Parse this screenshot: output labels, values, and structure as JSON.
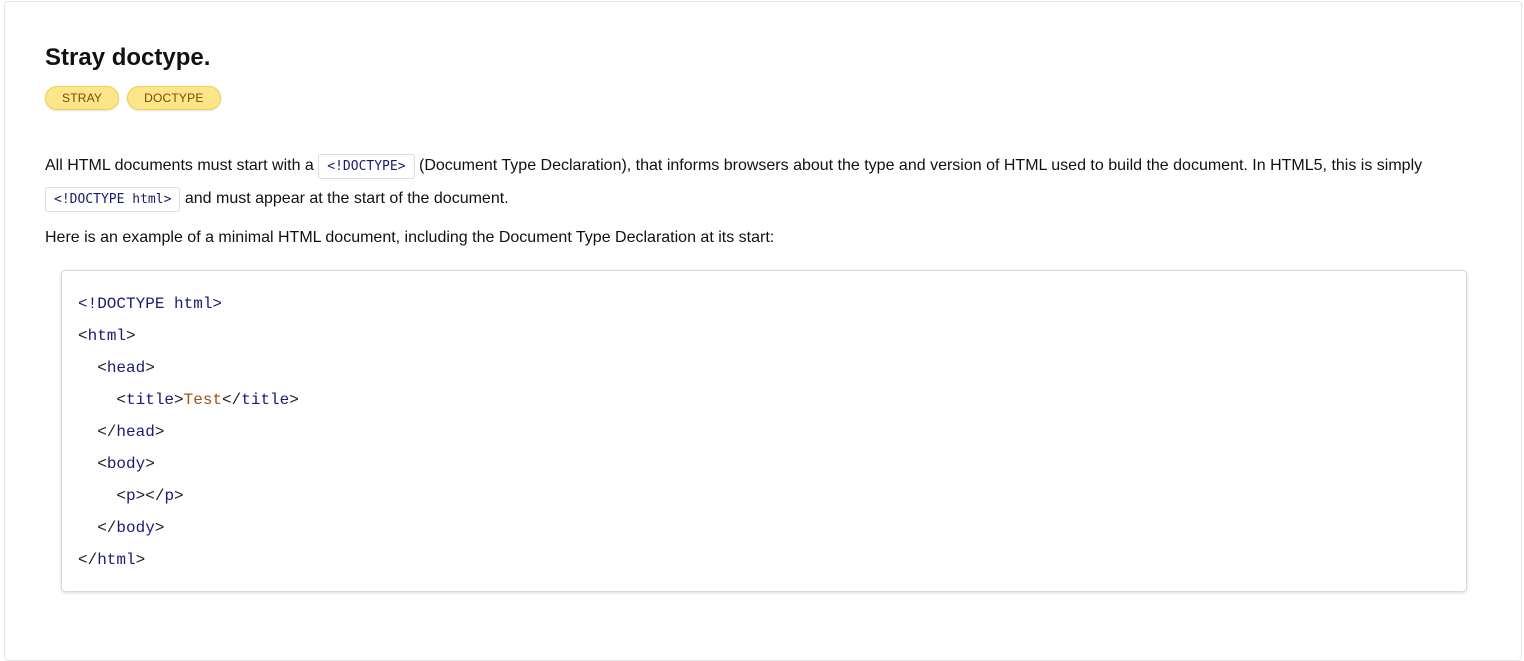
{
  "heading": {
    "title": "Stray doctype."
  },
  "tags": [
    "STRAY",
    "DOCTYPE"
  ],
  "intro": {
    "part1": "All HTML documents must start with a ",
    "code1": "<!DOCTYPE>",
    "part2": " (Document Type Declaration), that informs browsers about the type and version of HTML used to build the document. In HTML5, this is simply ",
    "code2": "<!DOCTYPE html>",
    "part3": " and must appear at the start of the document."
  },
  "example_intro": "Here is an example of a minimal HTML document, including the Document Type Declaration at its start:",
  "code": {
    "doctype": "<!DOCTYPE html>",
    "html_tag": "html",
    "head_tag": "head",
    "title_tag": "title",
    "title_text": "Test",
    "body_tag": "body",
    "p_tag": "p"
  },
  "colors": {
    "tag_background": "#fde68a",
    "tag_text": "#7a4b00",
    "code_keyword": "#1a1a7a",
    "code_text_literal": "#a0521a"
  }
}
